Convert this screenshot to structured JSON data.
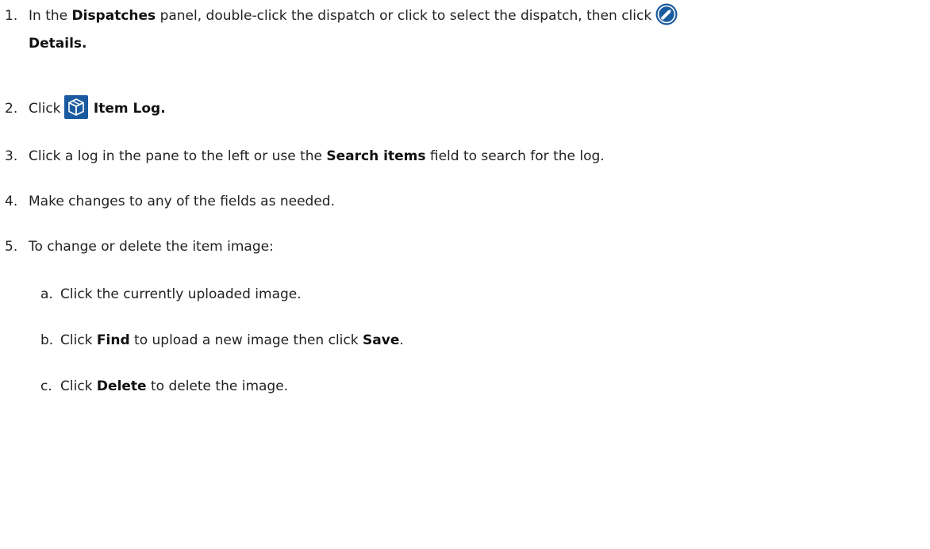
{
  "steps": [
    {
      "num": "1.",
      "pre": "In the",
      "bold1": "Dispatches",
      "mid": "panel, double-click the dispatch or click to select the dispatch, then click",
      "icon": "pencil-edit-icon",
      "bold2": "Details."
    },
    {
      "num": "2.",
      "pre": "Click",
      "icon": "box-icon",
      "bold": "Item Log."
    },
    {
      "num": "3.",
      "pre": "Click a log in the pane to the left or use the",
      "bold": "Search items",
      "post": "field to search for the log."
    },
    {
      "num": "4.",
      "text": "Make changes to any of the fields as needed."
    },
    {
      "num": "5.",
      "text": "To change or delete the item image:"
    }
  ],
  "substeps": [
    {
      "num": "a.",
      "text": "Click the currently uploaded image."
    },
    {
      "num": "b.",
      "pre": "Click",
      "bold1": "Find",
      "mid": "to upload a new image then click",
      "bold2": "Save",
      "post": "."
    },
    {
      "num": "c.",
      "pre": "Click",
      "bold": "Delete",
      "post": "to delete the image."
    }
  ],
  "colors": {
    "icon_blue": "#1a5aa0",
    "text": "#222222"
  }
}
